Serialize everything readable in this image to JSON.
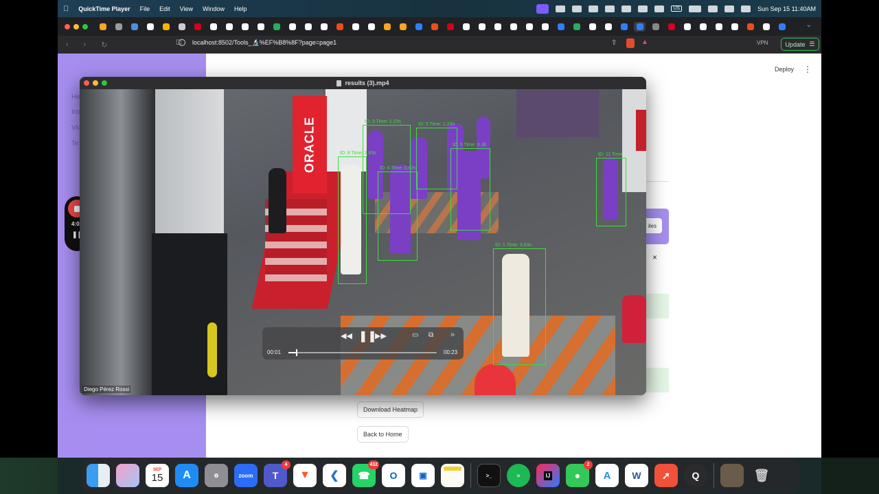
{
  "menubar": {
    "app_name": "QuickTime Player",
    "menus": [
      "File",
      "Edit",
      "View",
      "Window",
      "Help"
    ],
    "clock": "Sun Sep 15  11:40AM",
    "keyboard": "US"
  },
  "browser": {
    "url": "localhost:8502/Tools_🔬%EF%B8%8F?page=page1",
    "vpn_label": "VPN",
    "update_label": "Update"
  },
  "streamlit": {
    "deploy_label": "Deploy",
    "sidebar_links": [
      "He",
      "Ins",
      "Vid",
      "Te"
    ],
    "files_btn_label": "iles",
    "download_heatmap_label": "Download Heatmap",
    "back_home_label": "Back to Home",
    "close_symbol": "×"
  },
  "recorder": {
    "elapsed": "4:02"
  },
  "quicktime": {
    "window_title": "results (3).mp4",
    "current_time": "00:01",
    "end_time": "00:23",
    "progress": 0.05,
    "watermark": "Diego Pérez Rossi",
    "booth_sign": "ORACLE"
  },
  "detections": [
    {
      "label": "ID: 1  Time: 3.63s"
    },
    {
      "label": "ID: 3  Time: 1.23s"
    },
    {
      "label": "ID: 5  Time: 1.23s"
    },
    {
      "label": "ID: 8  Time: 2.63s"
    },
    {
      "label": "ID: 6  Time: 0.63s"
    },
    {
      "label": "ID: 11  Time"
    },
    {
      "label": "ID: 9  Time: 0.36"
    }
  ],
  "dock": {
    "calendar_month": "SEP",
    "calendar_day": "15",
    "zoom_label": "zoom",
    "teams_badge": "4",
    "whatsapp_badge": "432",
    "messages_badge": "2"
  },
  "colors": {
    "sidebar": "#a68ef0",
    "detection_box": "#3fdc3f",
    "oracle_red": "#e0232e",
    "recorder_red": "#ef4a4a"
  }
}
